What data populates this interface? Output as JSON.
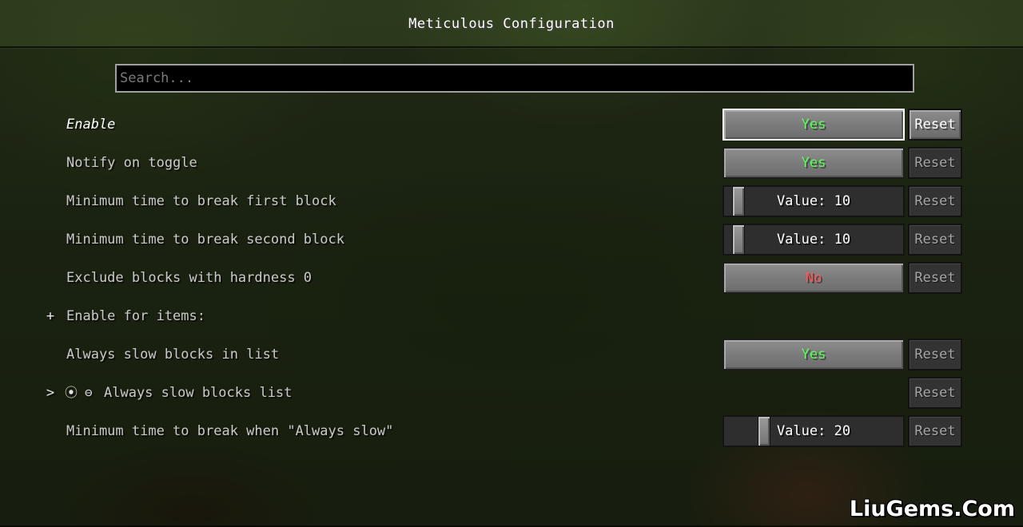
{
  "header": {
    "title": "Meticulous Configuration"
  },
  "search": {
    "placeholder": "Search..."
  },
  "options": [
    {
      "label": "Enable",
      "value": "Yes",
      "reset": "Reset"
    },
    {
      "label": "Notify on toggle",
      "value": "Yes",
      "reset": "Reset"
    },
    {
      "label": "Minimum time to break first block",
      "value": "Value: 10",
      "slider_fraction": 0.05,
      "reset": "Reset"
    },
    {
      "label": "Minimum time to break second block",
      "value": "Value: 10",
      "slider_fraction": 0.05,
      "reset": "Reset"
    },
    {
      "label": "Exclude blocks with hardness 0",
      "value": "No",
      "reset": "Reset"
    },
    {
      "label": "Enable for items:",
      "expander": "+"
    },
    {
      "label": "Always slow blocks in list",
      "value": "Yes",
      "reset": "Reset"
    },
    {
      "label": "Always slow blocks list",
      "expander": ">",
      "icons": [
        "⦿",
        "⊖"
      ],
      "reset": "Reset"
    },
    {
      "label": "Minimum time to break when \"Always slow\"",
      "value": "Value: 20",
      "slider_fraction": 0.2,
      "reset": "Reset"
    }
  ],
  "colors": {
    "yes": "#55ff55",
    "no": "#ff5555"
  },
  "watermark": "LiuGems.Com"
}
